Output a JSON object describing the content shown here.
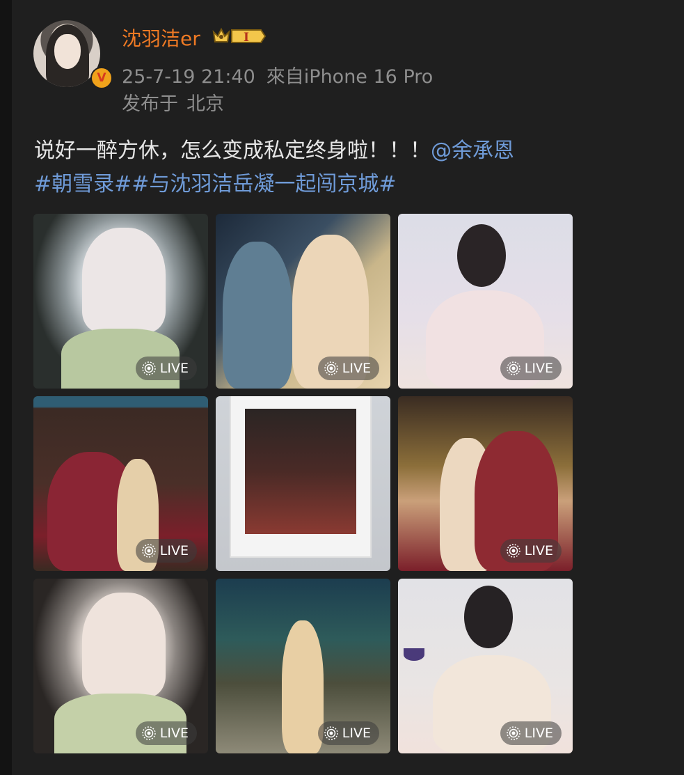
{
  "post": {
    "username": "沈羽洁er",
    "vip_level": "I",
    "timestamp": "25-7-19 21:40",
    "source": "來自iPhone 16 Pro",
    "location_prefix": "发布于",
    "location": "北京",
    "text": "说好一醉方休，怎么变成私定终身啦！！！",
    "mention": "@余承恩",
    "hashtag_1": "#朝雪录#",
    "hashtag_2": "#与沈羽洁岳凝一起闯京城#"
  },
  "photos": [
    {
      "badge": "LIVE",
      "badge_icon": "live-photo-icon"
    },
    {
      "badge": "LIVE",
      "badge_icon": "live-photo-icon"
    },
    {
      "badge": "LIVE",
      "badge_icon": "live-photo-icon"
    },
    {
      "badge": "LIVE",
      "badge_icon": "live-photo-icon"
    },
    {
      "badge": "",
      "badge_icon": ""
    },
    {
      "badge": "LIVE",
      "badge_icon": "live-photo-icon"
    },
    {
      "badge": "LIVE",
      "badge_icon": "live-photo-icon"
    },
    {
      "badge": "LIVE",
      "badge_icon": "live-photo-icon"
    },
    {
      "badge": "LIVE",
      "badge_icon": "live-photo-icon"
    }
  ],
  "colors": {
    "background": "#1f1f1f",
    "username": "#f07a24",
    "meta": "#8e8e8e",
    "text": "#e6e6e6",
    "link": "#6f9bd8",
    "verified": "#f0a21b"
  }
}
